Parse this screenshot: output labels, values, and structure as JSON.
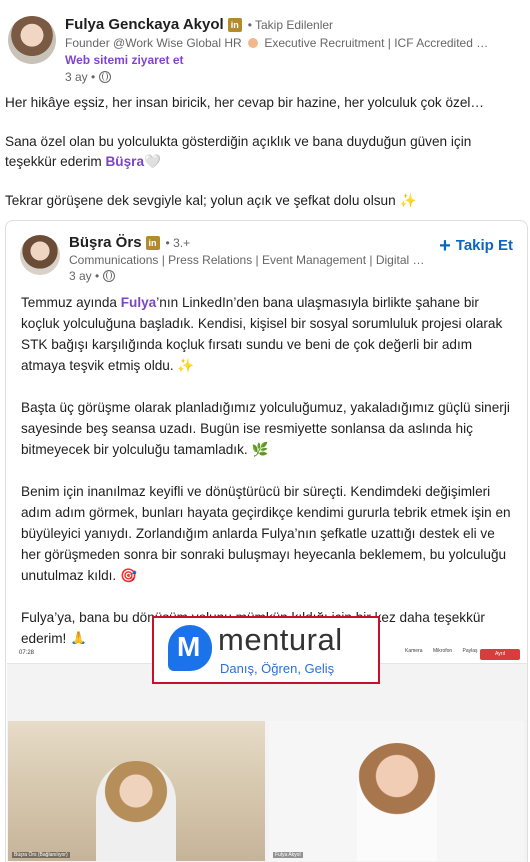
{
  "post": {
    "author_name": "Fulya Genckaya Akyol",
    "badge": "in",
    "follow_status": "• Takip Edilenler",
    "headline_part1": "Founder @Work Wise Global HR",
    "headline_part2": "Executive Recruitment | ICF Accredited Pr...",
    "website_link": "Web sitemi ziyaret et",
    "timestamp": "3 ay •",
    "text": {
      "p1": "Her hikâye eşsiz, her insan biricik, her cevap bir hazine, her yolculuk çok özel…",
      "p2_a": "Sana özel olan bu yolculukta gösterdiğin açıklık ve bana duyduğun güven için teşekkür ederim ",
      "p2_mention": "Büşra",
      "p2_emoji": "🤍",
      "p3_a": "Tekrar görüşene dek sevgiyle kal; yolun açık ve şefkat dolu olsun ",
      "p3_emoji": "✨"
    }
  },
  "shared": {
    "author_name": "Büşra Örs",
    "badge": "in",
    "degree": "• 3.+",
    "headline": "Communications | Press Relations | Event Management | Digital M...",
    "timestamp": "3 ay •",
    "follow_label": "Takip Et",
    "text": {
      "p1_a": "Temmuz ayında ",
      "p1_mention": "Fulya",
      "p1_b": "’nın LinkedIn’den bana ulaşmasıyla birlikte şahane bir koçluk yolculuğuna başladık. Kendisi, kişisel bir sosyal sorumluluk projesi olarak STK bağışı karşılığında koçluk fırsatı sundu ve beni de çok değerli bir adım atmaya teşvik etmiş oldu. ",
      "p1_emoji": "✨",
      "p2": "Başta üç görüşme olarak planladığımız yolculuğumuz, yakaladığımız güçlü sinerji sayesinde beş seansa uzadı. Bugün ise resmiyette sonlansa da aslında hiç bitmeyecek bir yolculuğu tamamladık. ",
      "p2_emoji": "🌿",
      "p3": "Benim için inanılmaz keyifli ve dönüştürücü bir süreçti. Kendimdeki değişimleri adım adım görmek, bunları hayata geçirdikçe kendimi gururla tebrik etmek işin en büyüleyici yanıydı. Zorlandığım anlarda Fulya’nın şefkatle uzattığı destek eli ve her görüşmeden sonra bir sonraki buluşmayı heyecanla beklemem, bu yolculuğu unutulmaz kıldı. ",
      "p3_emoji": "🎯",
      "p4": "Fulya’ya, bana bu dönüşüm yolunu mümkün kıldığı için bir kez daha teşekkür ederim! ",
      "p4_emoji": "🙏"
    }
  },
  "image": {
    "call_time": "07:28",
    "camera_label": "Kamera",
    "mic_label": "Mikrofon",
    "share_label": "Paylaş",
    "end_label": "Ayrıl",
    "left_tile_name": "Büşra Örs (Bağlanılıyor)",
    "right_tile_name": "Fulya Akyol",
    "logo_word": "mentural",
    "logo_tagline": "Danış, Öğren, Geliş",
    "logo_color": "#1a73e8",
    "highlight_color": "#c8102e"
  },
  "colors": {
    "link_blue": "#0a66c2",
    "mention_purple": "#7a46c4"
  }
}
